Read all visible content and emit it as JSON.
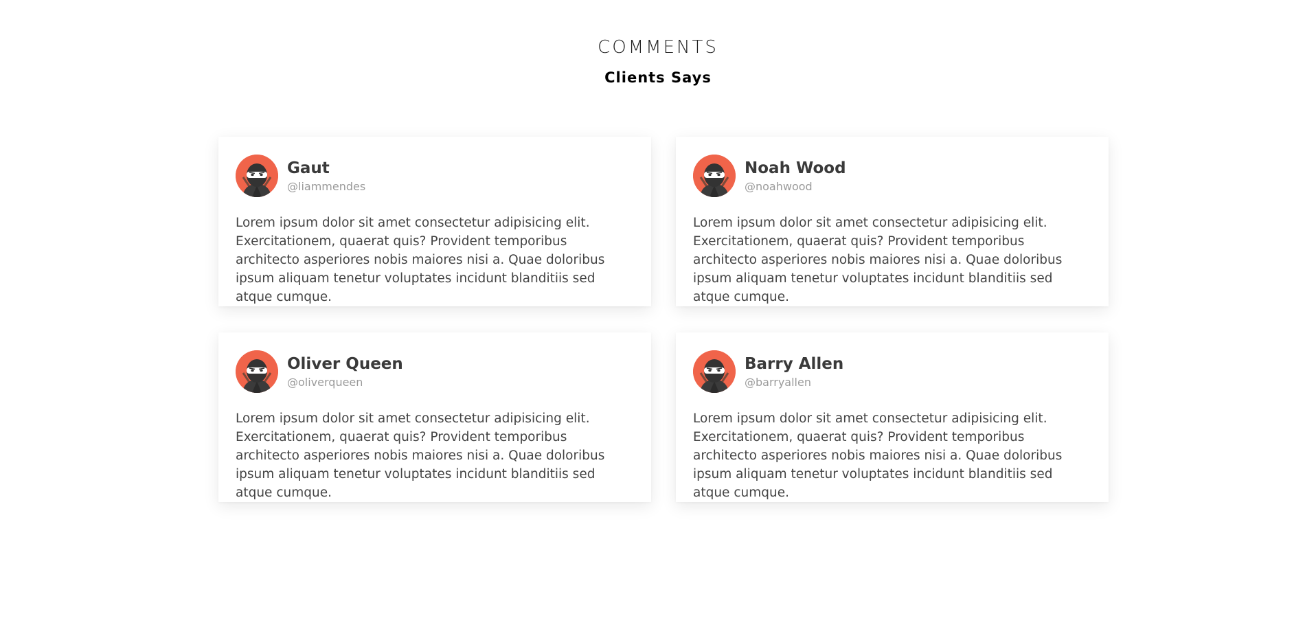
{
  "section": {
    "title": "COMMENTS",
    "subtitle": "Clients Says"
  },
  "colors": {
    "avatar_background": "#f0644a",
    "name_text": "#3a3a3a",
    "handle_text": "#9a9a9a",
    "body_text": "#444444"
  },
  "comments": [
    {
      "name": "Gaut",
      "handle": "@liammendes",
      "avatar_icon": "ninja-avatar-icon",
      "text": "Lorem ipsum dolor sit amet consectetur adipisicing elit. Exercitationem, quaerat quis? Provident temporibus architecto asperiores nobis maiores nisi a. Quae doloribus ipsum aliquam tenetur voluptates incidunt blanditiis sed atque cumque."
    },
    {
      "name": "Noah Wood",
      "handle": "@noahwood",
      "avatar_icon": "ninja-avatar-icon",
      "text": "Lorem ipsum dolor sit amet consectetur adipisicing elit. Exercitationem, quaerat quis? Provident temporibus architecto asperiores nobis maiores nisi a. Quae doloribus ipsum aliquam tenetur voluptates incidunt blanditiis sed atque cumque."
    },
    {
      "name": "Oliver Queen",
      "handle": "@oliverqueen",
      "avatar_icon": "ninja-avatar-icon",
      "text": "Lorem ipsum dolor sit amet consectetur adipisicing elit. Exercitationem, quaerat quis? Provident temporibus architecto asperiores nobis maiores nisi a. Quae doloribus ipsum aliquam tenetur voluptates incidunt blanditiis sed atque cumque."
    },
    {
      "name": "Barry Allen",
      "handle": "@barryallen",
      "avatar_icon": "ninja-avatar-icon",
      "text": "Lorem ipsum dolor sit amet consectetur adipisicing elit. Exercitationem, quaerat quis? Provident temporibus architecto asperiores nobis maiores nisi a. Quae doloribus ipsum aliquam tenetur voluptates incidunt blanditiis sed atque cumque."
    }
  ]
}
